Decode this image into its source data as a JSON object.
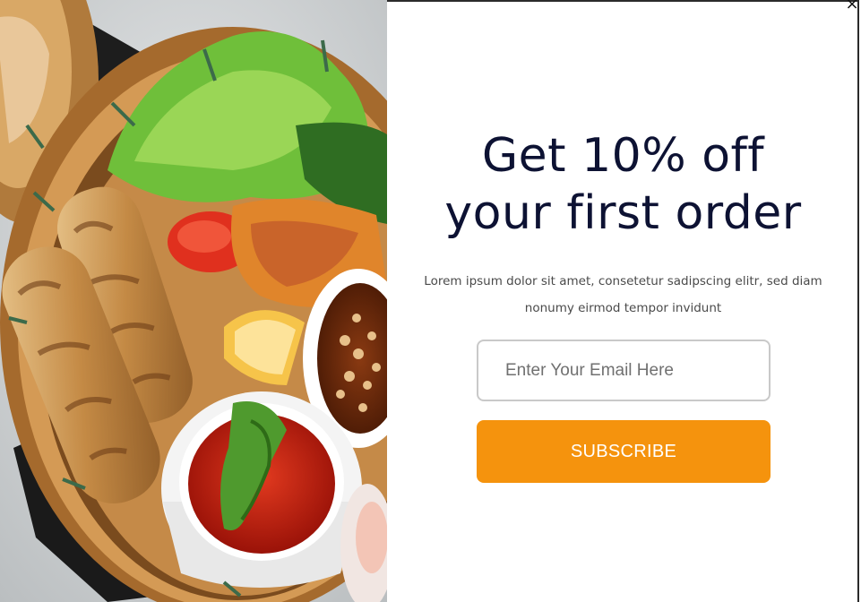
{
  "popup": {
    "close_symbol": "×",
    "close_icon": "close-icon",
    "image_alt": "food-photo",
    "headline_line1": "Get 10% off",
    "headline_line2": "your first order",
    "description": "Lorem ipsum dolor sit amet, consetetur sadipscing elitr, sed diam nonumy eirmod tempor invidunt",
    "email_placeholder": "Enter Your Email Here",
    "email_value": "",
    "subscribe_label": "SUBSCRIBE"
  },
  "colors": {
    "headline": "#0d1233",
    "accent": "#f5930d",
    "text": "#4a4a4a",
    "border": "#c9c9c9"
  }
}
